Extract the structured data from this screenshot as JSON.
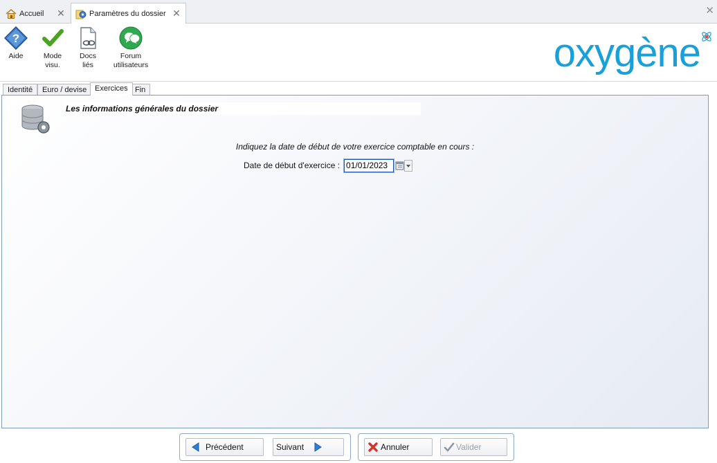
{
  "doc_tabs": [
    {
      "label": "Accueil",
      "icon": "home-icon"
    },
    {
      "label": "Paramètres du dossier",
      "icon": "settings-gear-icon"
    }
  ],
  "ribbon": {
    "aide": {
      "line1": "Aide",
      "line2": ""
    },
    "mode": {
      "line1": "Mode",
      "line2": "visu."
    },
    "docs": {
      "line1": "Docs",
      "line2": "liés"
    },
    "forum": {
      "line1": "Forum",
      "line2": "utilisateurs"
    }
  },
  "logo": {
    "text": "oxygène",
    "color": "#1aa0d8"
  },
  "form_tabs": [
    "Identité",
    "Euro / devise",
    "Exercices",
    "Fin"
  ],
  "active_form_tab": "Exercices",
  "panel": {
    "title": "Les informations générales du dossier",
    "prompt": "Indiquez la date de début de votre exercice comptable en cours :",
    "date_label": "Date de début d'exercice :",
    "date_value": "01/01/2023"
  },
  "buttons": {
    "prev": "Précédent",
    "next": "Suivant",
    "cancel": "Annuler",
    "validate": "Valider"
  },
  "colors": {
    "accent": "#1aa0d8",
    "panel_border": "#7f9db9",
    "disabled_text": "#9aa0a8"
  }
}
